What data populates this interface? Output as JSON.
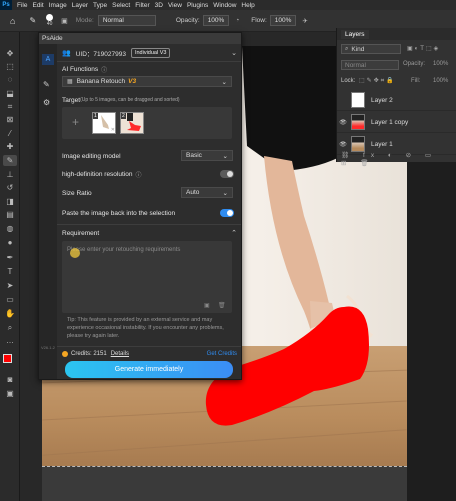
{
  "menu": [
    "File",
    "Edit",
    "Image",
    "Layer",
    "Type",
    "Select",
    "Filter",
    "3D",
    "View",
    "Plugins",
    "Window",
    "Help"
  ],
  "options_bar": {
    "brush_size": "40",
    "mode_label": "Mode:",
    "mode_value": "Normal",
    "opacity_label": "Opacity:",
    "opacity_value": "100%",
    "flow_label": "Flow:",
    "flow_value": "100%"
  },
  "plugin": {
    "title": "PsAide",
    "uid": "UID：719027993",
    "plan": "Individual V3",
    "ai_functions_label": "AI Functions",
    "ai_function_value": "Banana Retouch",
    "ai_function_version": "V3",
    "target_label": "Target",
    "target_hint": "(Up to 5 images, can be dragged and sorted)",
    "thumb1_index": "1",
    "thumb2_index": "2",
    "editing_model_label": "Image editing model",
    "editing_model_value": "Basic",
    "hd_label": "high-definition resolution",
    "hd_enabled": false,
    "size_ratio_label": "Size Ratio",
    "size_ratio_value": "Auto",
    "paste_back_label": "Paste the image back into the selection",
    "paste_back_enabled": true,
    "requirement_label": "Requirement",
    "requirement_placeholder": "Please enter your retouching requirements",
    "tip": "Tip: This feature is provided by an external service and may experience occasional instability. If you encounter any problems, please try again later.",
    "credits_label": "Credits: 2151",
    "details_link": "Details",
    "get_credits": "Get Credits",
    "generate_button": "Generate immediately",
    "version": "V26.1.2"
  },
  "layers_panel": {
    "tab": "Layers",
    "kind_label": "Kind",
    "blend_mode": "Normal",
    "opacity_label": "Opacity:",
    "opacity_value": "100%",
    "lock_label": "Lock:",
    "fill_label": "Fill:",
    "fill_value": "100%",
    "layers": [
      {
        "name": "Layer 2",
        "visible": false
      },
      {
        "name": "Layer 1 copy",
        "visible": true
      },
      {
        "name": "Layer 1",
        "visible": true
      }
    ]
  },
  "colors": {
    "accent_blue": "#2f8cf0",
    "generate_gradient_start": "#2bc5f0",
    "generate_gradient_end": "#3b8df5",
    "mask_red": "#ff0000",
    "credits_icon": "#f5a623"
  }
}
